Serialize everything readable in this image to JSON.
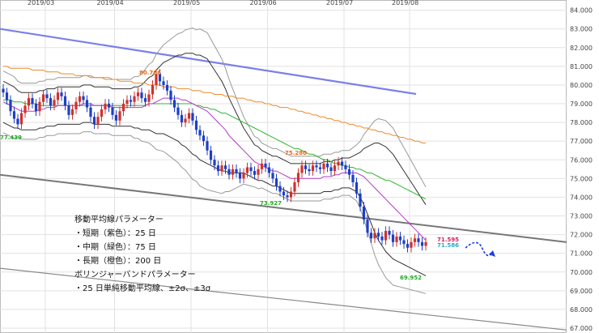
{
  "chart_data": {
    "type": "candlestick",
    "x_tick_labels": [
      "2019/03",
      "2019/04",
      "2019/05",
      "2019/06",
      "2019/07",
      "2019/08"
    ],
    "y_tick_labels": [
      "84.000",
      "83.000",
      "82.000",
      "81.000",
      "80.000",
      "79.000",
      "78.000",
      "77.000",
      "76.000",
      "75.000",
      "74.000",
      "73.000",
      "72.000",
      "71.000",
      "70.000",
      "69.000",
      "68.000",
      "67.000"
    ],
    "ylim": [
      67,
      84.2
    ],
    "grid": true,
    "price_labels": [
      {
        "text": "80.766",
        "color": "#e06b1c",
        "value": 80.766
      },
      {
        "text": "77.439",
        "color": "#22aa22",
        "value": 77.44
      },
      {
        "text": "75.280",
        "color": "#e06b1c",
        "value": 75.28
      },
      {
        "text": "73.927",
        "color": "#22aa22",
        "value": 73.93
      },
      {
        "text": "69.952",
        "color": "#22aa22",
        "value": 69.95
      },
      {
        "text": "71.595",
        "color": "#d81b60",
        "value": 71.595
      },
      {
        "text": "71.586",
        "color": "#2aa7c9",
        "value": 71.586
      }
    ],
    "closes": [
      79.6,
      79.2,
      78.6,
      78.2,
      77.9,
      78.5,
      78.9,
      79.3,
      79.0,
      78.6,
      79.1,
      79.5,
      79.3,
      78.9,
      79.2,
      79.6,
      79.4,
      78.9,
      78.4,
      78.7,
      79.1,
      79.4,
      79.2,
      78.8,
      78.3,
      77.9,
      78.3,
      78.7,
      79.0,
      78.8,
      78.4,
      78.1,
      78.6,
      79.0,
      79.2,
      79.1,
      79.4,
      79.6,
      79.3,
      79.1,
      79.5,
      80.0,
      80.6,
      80.2,
      80.0,
      79.7,
      79.2,
      78.8,
      78.4,
      78.0,
      78.2,
      78.5,
      78.1,
      77.6,
      77.3,
      77.0,
      76.5,
      76.0,
      75.7,
      75.4,
      75.7,
      75.5,
      75.2,
      75.5,
      75.3,
      75.0,
      75.3,
      75.6,
      75.4,
      75.2,
      75.5,
      75.8,
      75.6,
      75.3,
      75.0,
      74.6,
      74.3,
      74.1,
      74.0,
      74.3,
      74.8,
      75.3,
      75.7,
      75.5,
      75.4,
      75.7,
      75.6,
      75.5,
      75.8,
      75.6,
      75.4,
      75.7,
      75.9,
      75.7,
      75.5,
      75.2,
      74.8,
      74.2,
      73.5,
      72.8,
      72.1,
      71.8,
      72.1,
      71.9,
      71.7,
      72.2,
      72.0,
      71.6,
      71.9,
      71.7,
      71.5,
      71.3,
      71.6,
      71.8,
      71.6,
      71.4,
      71.6
    ],
    "sma_short": {
      "name": "短期",
      "color": "#b33ac7",
      "values": [
        79.1,
        79.0,
        78.9,
        78.8,
        78.7,
        78.6,
        78.6,
        78.6,
        78.6,
        78.6,
        78.7,
        78.7,
        78.8,
        78.8,
        78.8,
        78.9,
        78.9,
        78.9,
        78.9,
        78.9,
        78.9,
        78.9,
        79.0,
        79.0,
        79.0,
        78.9,
        78.9,
        78.9,
        78.9,
        78.9,
        78.8,
        78.8,
        78.8,
        78.8,
        78.8,
        78.8,
        78.8,
        78.8,
        78.8,
        78.9,
        79.0,
        79.0,
        79.1,
        79.2,
        79.3,
        79.3,
        79.3,
        79.3,
        79.3,
        79.2,
        79.2,
        79.1,
        79.0,
        78.9,
        78.8,
        78.7,
        78.6,
        78.4,
        78.2,
        78.0,
        77.8,
        77.6,
        77.3,
        77.1,
        76.9,
        76.7,
        76.5,
        76.3,
        76.1,
        75.9,
        75.8,
        75.7,
        75.6,
        75.5,
        75.4,
        75.4,
        75.3,
        75.2,
        75.1,
        75.0,
        75.0,
        75.0,
        75.0,
        75.0,
        75.0,
        75.0,
        75.0,
        75.0,
        75.1,
        75.1,
        75.1,
        75.2,
        75.2,
        75.3,
        75.3,
        75.3,
        75.3,
        75.3,
        75.2,
        75.1,
        74.9,
        74.7,
        74.5,
        74.3,
        74.1,
        73.9,
        73.7,
        73.5,
        73.3,
        73.1,
        72.9,
        72.7,
        72.5,
        72.3,
        72.1,
        71.9,
        71.7
      ]
    },
    "sma_mid": {
      "name": "中期",
      "color": "#2fb52f",
      "values": [
        79.2,
        79.2,
        79.2,
        79.1,
        79.1,
        79.1,
        79.0,
        79.0,
        79.0,
        79.0,
        78.9,
        78.9,
        78.9,
        78.9,
        78.9,
        78.9,
        78.9,
        78.9,
        78.9,
        78.9,
        78.9,
        78.9,
        78.9,
        78.9,
        78.9,
        78.9,
        78.9,
        78.9,
        78.9,
        78.9,
        78.9,
        78.9,
        78.9,
        78.9,
        78.9,
        78.9,
        78.9,
        78.9,
        78.9,
        78.9,
        79.0,
        79.0,
        79.0,
        79.0,
        79.0,
        79.0,
        79.0,
        79.0,
        79.0,
        79.0,
        79.0,
        79.0,
        79.0,
        78.9,
        78.9,
        78.8,
        78.8,
        78.7,
        78.7,
        78.6,
        78.5,
        78.5,
        78.4,
        78.3,
        78.2,
        78.1,
        78.0,
        77.9,
        77.8,
        77.7,
        77.6,
        77.5,
        77.4,
        77.3,
        77.2,
        77.1,
        77.0,
        76.9,
        76.8,
        76.7,
        76.6,
        76.6,
        76.5,
        76.4,
        76.3,
        76.3,
        76.2,
        76.1,
        76.0,
        76.0,
        75.9,
        75.8,
        75.8,
        75.7,
        75.7,
        75.6,
        75.6,
        75.5,
        75.5,
        75.4,
        75.3,
        75.3,
        75.2,
        75.1,
        75.0,
        74.9,
        74.9,
        74.8,
        74.7,
        74.6,
        74.5,
        74.4,
        74.3,
        74.2,
        74.1,
        74.0,
        73.9
      ]
    },
    "sma_long": {
      "name": "長期",
      "color": "#ee8a2a",
      "values": [
        81.0,
        81.0,
        80.9,
        80.9,
        80.9,
        80.9,
        80.9,
        80.9,
        80.8,
        80.8,
        80.8,
        80.8,
        80.7,
        80.7,
        80.7,
        80.7,
        80.6,
        80.6,
        80.6,
        80.6,
        80.5,
        80.5,
        80.5,
        80.5,
        80.4,
        80.4,
        80.4,
        80.4,
        80.3,
        80.3,
        80.3,
        80.3,
        80.2,
        80.2,
        80.2,
        80.2,
        80.1,
        80.1,
        80.1,
        80.1,
        80.0,
        80.0,
        80.0,
        80.0,
        79.9,
        79.9,
        79.9,
        79.9,
        79.8,
        79.8,
        79.8,
        79.8,
        79.7,
        79.7,
        79.7,
        79.6,
        79.6,
        79.6,
        79.5,
        79.5,
        79.5,
        79.4,
        79.4,
        79.4,
        79.3,
        79.3,
        79.3,
        79.2,
        79.2,
        79.1,
        79.1,
        79.1,
        79.0,
        79.0,
        78.9,
        78.9,
        78.8,
        78.8,
        78.8,
        78.7,
        78.7,
        78.6,
        78.6,
        78.5,
        78.5,
        78.4,
        78.4,
        78.3,
        78.3,
        78.2,
        78.2,
        78.1,
        78.1,
        78.0,
        78.0,
        77.9,
        77.9,
        77.8,
        77.8,
        77.7,
        77.7,
        77.6,
        77.6,
        77.5,
        77.5,
        77.4,
        77.4,
        77.3,
        77.3,
        77.2,
        77.2,
        77.1,
        77.1,
        77.0,
        77.0,
        76.9,
        76.9
      ]
    },
    "bollinger_width_2s": [
      1.1,
      1.1,
      1.1,
      1.1,
      1.0,
      1.0,
      1.0,
      1.0,
      1.0,
      1.0,
      1.0,
      1.0,
      1.0,
      1.0,
      1.0,
      1.0,
      1.0,
      1.0,
      1.0,
      1.0,
      1.0,
      1.0,
      1.0,
      1.0,
      1.0,
      1.0,
      1.0,
      1.0,
      1.0,
      1.0,
      1.0,
      1.0,
      1.0,
      1.0,
      1.0,
      1.0,
      1.1,
      1.1,
      1.2,
      1.3,
      1.4,
      1.5,
      1.7,
      1.8,
      1.9,
      2.0,
      2.1,
      2.2,
      2.3,
      2.4,
      2.5,
      2.6,
      2.7,
      2.7,
      2.8,
      2.8,
      2.8,
      2.7,
      2.6,
      2.5,
      2.4,
      2.2,
      2.0,
      1.8,
      1.6,
      1.4,
      1.2,
      1.1,
      1.0,
      0.9,
      0.9,
      0.8,
      0.8,
      0.8,
      0.8,
      0.8,
      0.8,
      0.8,
      0.8,
      0.8,
      0.8,
      0.8,
      0.8,
      0.8,
      0.8,
      0.8,
      0.8,
      0.8,
      0.8,
      0.8,
      0.8,
      0.8,
      0.8,
      0.8,
      0.8,
      0.8,
      0.9,
      1.0,
      1.2,
      1.5,
      1.8,
      2.1,
      2.4,
      2.6,
      2.7,
      2.8,
      2.8,
      2.8,
      2.7,
      2.6,
      2.5,
      2.4,
      2.3,
      2.2,
      2.1,
      2.0,
      1.9
    ],
    "trendlines": [
      {
        "name": "upper-channel-line",
        "color": "#7b7fe8",
        "from": [
          0,
          83.0
        ],
        "to": [
          116,
          79.7
        ]
      },
      {
        "name": "middle-channel-line",
        "color": "#777777",
        "from": [
          0,
          75.2
        ],
        "to": [
          116,
          71.6
        ]
      },
      {
        "name": "lower-channel-line",
        "color": "#888888",
        "from": [
          0,
          70.2
        ],
        "to": [
          116,
          66.9
        ]
      }
    ],
    "legend_lines": [
      "移動平均線パラメーター",
      "・短期（紫色）：25 日",
      "・中期（緑色）：75 日",
      "・長期（橙色）：200 日",
      "ボリンジャーバンドパラメーター",
      "・25 日単純移動平均線、±2σ、±3σ"
    ]
  }
}
